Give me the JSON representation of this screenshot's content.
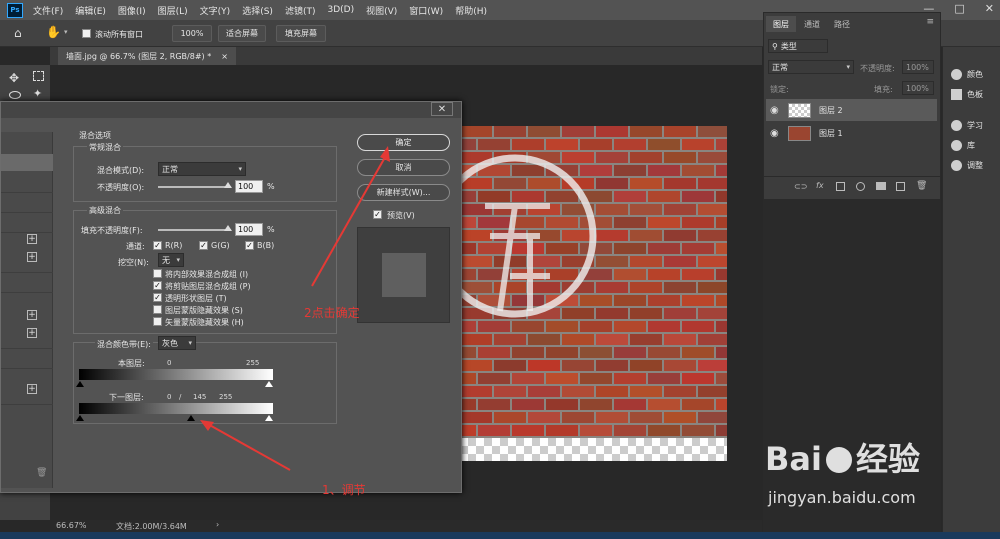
{
  "app": {
    "logo": "Ps"
  },
  "menu": [
    "文件(F)",
    "编辑(E)",
    "图像(I)",
    "图层(L)",
    "文字(Y)",
    "选择(S)",
    "滤镜(T)",
    "3D(D)",
    "视图(V)",
    "窗口(W)",
    "帮助(H)"
  ],
  "window_controls": [
    "—",
    "□",
    "✕"
  ],
  "options_bar": {
    "scroll_all_label": "滚动所有窗口",
    "zoom": "100%",
    "fit_screen": "适合屏幕",
    "fill_screen": "填充屏幕"
  },
  "document_tab": {
    "title": "墙面.jpg @ 66.7% (图层 2, RGB/8#) *",
    "close": "×"
  },
  "status": {
    "zoom": "66.67%",
    "doc": "文档:2.00M/3.64M"
  },
  "layers_panel": {
    "tabs": [
      "图层",
      "通道",
      "路径"
    ],
    "filter_label": "类型",
    "blend_mode": "正常",
    "opacity_label": "不透明度:",
    "opacity": "100%",
    "lock_label": "锁定:",
    "fill_label": "填充:",
    "fill": "100%",
    "layers": [
      {
        "name": "图层 2",
        "selected": true
      },
      {
        "name": "图层 1",
        "selected": false
      }
    ]
  },
  "side_panels": [
    "颜色",
    "色板",
    "学习",
    "库",
    "调整"
  ],
  "dialog": {
    "blend_options_title": "混合选项",
    "general_blending": "常规混合",
    "blend_mode_label": "混合模式(D):",
    "blend_mode_value": "正常",
    "opacity_label": "不透明度(O):",
    "opacity_value": "100",
    "percent": "%",
    "advanced_blending": "高级混合",
    "fill_opacity_label": "填充不透明度(F):",
    "fill_opacity_value": "100",
    "channels_label": "通道:",
    "channels": [
      "R(R)",
      "G(G)",
      "B(B)"
    ],
    "knockout_label": "挖空(N):",
    "knockout_value": "无",
    "options": [
      {
        "label": "将内部效果混合成组 (I)",
        "checked": false
      },
      {
        "label": "将剪贴图层混合成组 (P)",
        "checked": true
      },
      {
        "label": "透明形状图层 (T)",
        "checked": true
      },
      {
        "label": "图层蒙版隐藏效果 (S)",
        "checked": false
      },
      {
        "label": "矢量蒙版隐藏效果 (H)",
        "checked": false
      }
    ],
    "blend_if_label": "混合颜色带(E):",
    "blend_if_value": "灰色",
    "this_layer_label": "本图层:",
    "this_layer_low": "0",
    "this_layer_high": "255",
    "underlying_label": "下一图层:",
    "underlying_low": "0",
    "underlying_sep": "/",
    "underlying_mid": "145",
    "underlying_high": "255",
    "ok": "确定",
    "cancel": "取消",
    "new_style": "新建样式(W)...",
    "preview": "预览(V)",
    "close": "✕"
  },
  "annotations": {
    "step1": "1、调节",
    "step2": "2点击确定"
  },
  "watermark": {
    "brand_left": "Bai",
    "brand_right": "经验",
    "url": "jingyan.baidu.com"
  },
  "colors": {
    "annotation": "#e53935",
    "brick": "#a0442f",
    "mortar": "#8a8580"
  }
}
